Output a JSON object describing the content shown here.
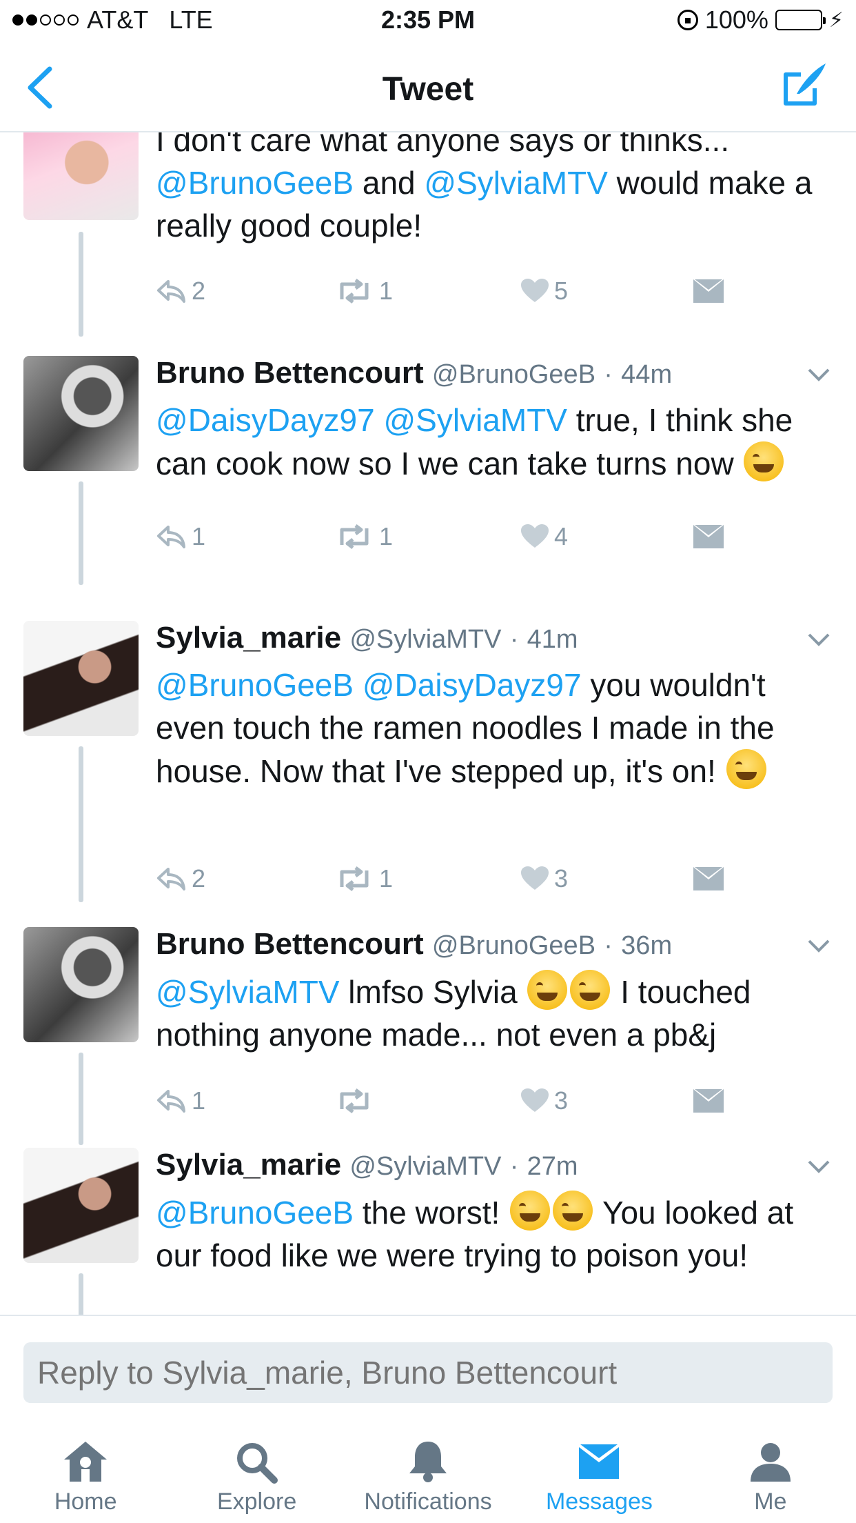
{
  "status_bar": {
    "carrier": "AT&T",
    "network": "LTE",
    "time": "2:35 PM",
    "battery": "100%",
    "battery_color": "#4cd964"
  },
  "nav": {
    "title": "Tweet",
    "back_icon": "chevron-left-icon",
    "compose_icon": "compose-tweet-icon",
    "accent_color": "#1da1f2"
  },
  "tweets": [
    {
      "name": "",
      "handle": "",
      "time": "",
      "text_parts": [
        "I don't care what anyone says or thinks... ",
        "@BrunoGeeB",
        " and ",
        "@SylviaMTV",
        " would make a really good couple!"
      ],
      "replies": "2",
      "retweets": "1",
      "likes": "5"
    },
    {
      "name": "Bruno Bettencourt",
      "handle": "@BrunoGeeB",
      "time": "44m",
      "text_parts": [
        "@DaisyDayz97",
        " ",
        "@SylviaMTV",
        " true, I think she can cook now so I we can take turns now "
      ],
      "replies": "1",
      "retweets": "1",
      "likes": "4"
    },
    {
      "name": "Sylvia_marie",
      "handle": "@SylviaMTV",
      "time": "41m",
      "text_parts": [
        "@BrunoGeeB",
        " ",
        "@DaisyDayz97",
        " you wouldn't even touch the ramen noodles I made in the house. Now that I've stepped up, it's on! "
      ],
      "replies": "2",
      "retweets": "1",
      "likes": "3"
    },
    {
      "name": "Bruno Bettencourt",
      "handle": "@BrunoGeeB",
      "time": "36m",
      "text_parts": [
        "@SylviaMTV",
        " lmfso Sylvia ",
        " I touched nothing anyone made... not even a pb&j"
      ],
      "replies": "1",
      "retweets": "",
      "likes": "3"
    },
    {
      "name": "Sylvia_marie",
      "handle": "@SylviaMTV",
      "time": "27m",
      "text_parts": [
        "@BrunoGeeB",
        " the worst! ",
        " You looked at our food like we were trying to poison you!"
      ],
      "replies": "",
      "retweets": "",
      "likes": ""
    }
  ],
  "separator": "·",
  "reply": {
    "placeholder": "Reply to Sylvia_marie, Bruno Bettencourt"
  },
  "tabs": [
    {
      "label": "Home",
      "icon": "home-icon"
    },
    {
      "label": "Explore",
      "icon": "search-icon"
    },
    {
      "label": "Notifications",
      "icon": "bell-icon"
    },
    {
      "label": "Messages",
      "icon": "envelope-icon"
    },
    {
      "label": "Me",
      "icon": "person-icon"
    }
  ],
  "active_tab": "Messages"
}
